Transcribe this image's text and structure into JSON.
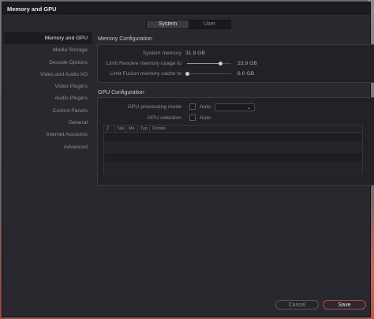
{
  "window": {
    "title": "Memory and GPU"
  },
  "tabs": [
    {
      "label": "System",
      "active": true
    },
    {
      "label": "User",
      "active": false
    }
  ],
  "sidebar": {
    "items": [
      {
        "label": "Memory and GPU",
        "active": true
      },
      {
        "label": "Media Storage"
      },
      {
        "label": "Decode Options"
      },
      {
        "label": "Video and Audio I/O"
      },
      {
        "label": "Video Plugins"
      },
      {
        "label": "Audio Plugins"
      },
      {
        "label": "Control Panels"
      },
      {
        "label": "General"
      },
      {
        "label": "Internet Accounts"
      },
      {
        "label": "Advanced"
      }
    ]
  },
  "memory": {
    "section_title": "Memory Configuration",
    "system_memory_label": "System memory",
    "system_memory_value": "31.9 GB",
    "resolve_limit_label": "Limit Resolve memory usage to",
    "resolve_limit_value": "23.9 GB",
    "resolve_limit_fraction": 0.75,
    "fusion_limit_label": "Limit Fusion memory cache to",
    "fusion_limit_value": "6.0 GB",
    "fusion_limit_fraction": 0.0
  },
  "gpu": {
    "section_title": "GPU Configuration",
    "processing_mode_label": "GPU processing mode",
    "processing_mode_auto": "Auto",
    "processing_mode_auto_checked": false,
    "processing_mode_selected": "",
    "selection_label": "GPU selection",
    "selection_auto": "Auto",
    "selection_auto_checked": false,
    "table_columns": [
      "2",
      "Nai",
      "Me",
      "Typ",
      "Details"
    ]
  },
  "buttons": {
    "cancel": "Cancel",
    "save": "Save"
  },
  "colors": {
    "accent": "#c0404a",
    "window_bg": "#28282e",
    "panel_bg": "#222226"
  }
}
